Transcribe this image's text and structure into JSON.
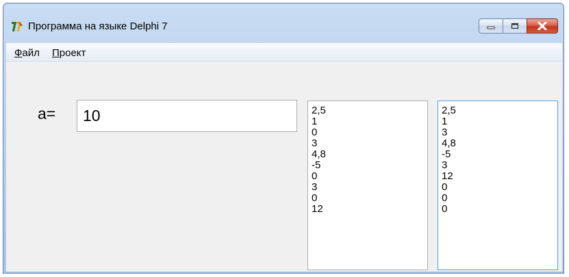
{
  "window": {
    "title": "Программа на языке Delphi 7",
    "icons": {
      "app": "delphi-app-icon",
      "minimize": "minimize-icon",
      "maximize": "maximize-icon",
      "close": "close-icon"
    }
  },
  "menu": {
    "file": {
      "accel": "Ф",
      "rest": "айл"
    },
    "project": {
      "accel": "П",
      "rest": "роект"
    }
  },
  "form": {
    "a_label": "a=",
    "a_value": "10"
  },
  "list1": [
    "2,5",
    "1",
    "0",
    "3",
    "4,8",
    "-5",
    "0",
    "3",
    "0",
    "12"
  ],
  "list2": [
    "2,5",
    "1",
    "3",
    "4,8",
    "-5",
    "3",
    "12",
    "0",
    "0",
    "0"
  ],
  "colors": {
    "close_button": "#c2381f",
    "focus_border": "#569de5",
    "client_bg": "#f0f0f0"
  }
}
